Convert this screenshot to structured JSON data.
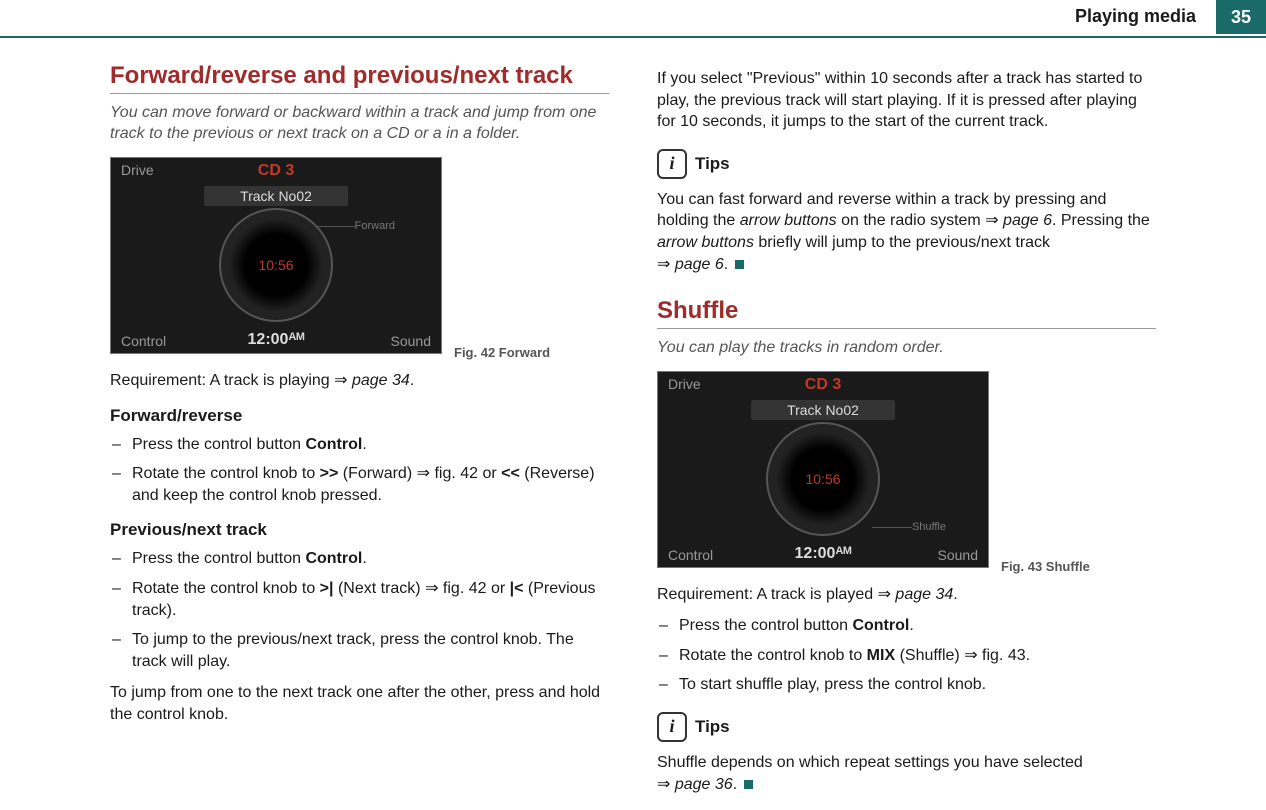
{
  "header": {
    "section_label": "Playing media",
    "page_number": "35"
  },
  "figure": {
    "drive": "Drive",
    "cd": "CD 3",
    "track": "Track No02",
    "time": "10:56",
    "forward_label": "Forward",
    "shuffle_label": "Shuffle",
    "control": "Control",
    "clock": "12:00ᴬᴹ",
    "sound": "Sound"
  },
  "left": {
    "title": "Forward/reverse and previous/next track",
    "lede": "You can move forward or backward within a track and jump from one track to the previous or next track on a CD or a in a folder.",
    "fig42": "Fig. 42   Forward",
    "requirement_a": "Requirement: A track is playing ",
    "requirement_b": "page 34",
    "requirement_c": ".",
    "subhead1": "Forward/reverse",
    "li1_a": "Press the control button ",
    "li1_b": "Control",
    "li1_c": ".",
    "li2_a": "Rotate the control knob to ",
    "li2_b": ">>",
    "li2_c": " (Forward) ",
    "li2_d": " fig. 42 or ",
    "li2_e": "<<",
    "li2_f": " (Reverse) and keep the control knob pressed.",
    "subhead2": "Previous/next track",
    "li3_a": "Press the control button ",
    "li3_b": "Control",
    "li3_c": ".",
    "li4_a": "Rotate the control knob to ",
    "li4_b": ">|",
    "li4_c": " (Next track) ",
    "li4_d": " fig. 42 or ",
    "li4_e": "|<",
    "li4_f": " (Previous track).",
    "li5": "To jump to the previous/next track, press the control knob. The track will play.",
    "para_end": "To jump from one to the next track one after the other, press and hold the control knob."
  },
  "right": {
    "p1": "If you select \"Previous\" within 10 seconds after a track has started to play, the previous track will start playing. If it is pressed after playing for 10 seconds, it jumps to the start of the current track.",
    "tips_label": "Tips",
    "tips1_a": "You can fast forward and reverse within a track by pressing and holding the ",
    "tips1_b": "arrow buttons",
    "tips1_c": " on the radio system ",
    "tips1_d": "page 6",
    "tips1_e": ". Pressing the ",
    "tips1_f": "arrow buttons",
    "tips1_g": " briefly will jump to the previous/next track ",
    "tips1_h": "page 6",
    "tips1_i": ".",
    "title2": "Shuffle",
    "lede2": "You can play the tracks in random order.",
    "fig43": "Fig. 43   Shuffle",
    "req2_a": "Requirement: A track is played ",
    "req2_b": "page 34",
    "req2_c": ".",
    "li6_a": "Press the control button ",
    "li6_b": "Control",
    "li6_c": ".",
    "li7_a": "Rotate the control knob to ",
    "li7_b": "MIX",
    "li7_c": " (Shuffle) ",
    "li7_d": " fig. 43.",
    "li8": "To start shuffle play, press the control knob.",
    "tips2_a": "Shuffle depends on which repeat settings you have selected ",
    "tips2_b": "page 36",
    "tips2_c": "."
  },
  "glyphs": {
    "arrow": "⇒"
  }
}
